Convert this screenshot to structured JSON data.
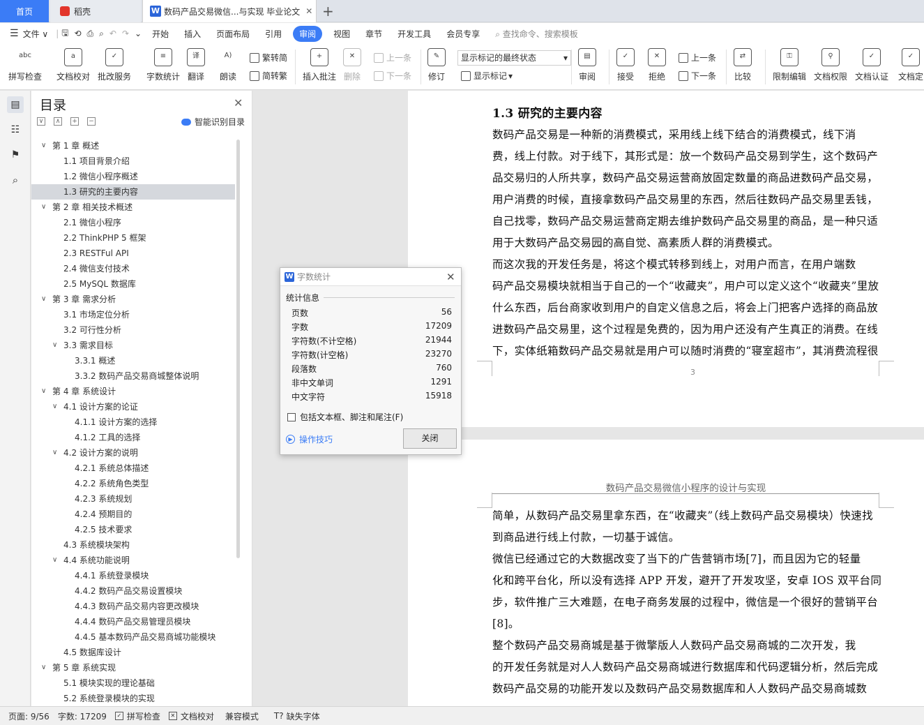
{
  "tabs": {
    "home": "首页",
    "daoke": "稻壳",
    "doc": "数码产品交易微信...与实现 毕业论文",
    "add": "+"
  },
  "menu": {
    "file": "文件",
    "items": [
      "开始",
      "插入",
      "页面布局",
      "引用",
      "审阅",
      "视图",
      "章节",
      "开发工具",
      "会员专享"
    ],
    "search": "查找命令、搜索模板"
  },
  "ribbon": {
    "spellcheck": "拼写检查",
    "doc_proof": "文档校对",
    "review_service": "批改服务",
    "word_count": "字数统计",
    "translate": "翻译",
    "read_aloud": "朗读",
    "trad": "繁转简",
    "simp": "简转繁",
    "insert_comment": "插入批注",
    "delete": "删除",
    "prev": "上一条",
    "next": "下一条",
    "revise": "修订",
    "show_state": "显示标记的最终状态",
    "show_marks": "显示标记",
    "review": "审阅",
    "accept": "接受",
    "reject": "拒绝",
    "prev2": "上一条",
    "next2": "下一条",
    "compare": "比较",
    "restrict": "限制编辑",
    "doc_rights": "文档权限",
    "doc_cert": "文档认证",
    "doc_final": "文档定"
  },
  "toc": {
    "title": "目录",
    "smart": "智能识别目录",
    "items": [
      {
        "text": "第 1 章  概述",
        "level": 1,
        "arrow": "∨"
      },
      {
        "text": "1.1  项目背景介绍",
        "level": 2
      },
      {
        "text": "1.2  微信小程序概述",
        "level": 2
      },
      {
        "text": "1.3  研究的主要内容",
        "level": 2,
        "selected": true
      },
      {
        "text": "第 2 章  相关技术概述",
        "level": 1,
        "arrow": "∨"
      },
      {
        "text": "2.1  微信小程序",
        "level": 2
      },
      {
        "text": "2.2 ThinkPHP 5  框架",
        "level": 2
      },
      {
        "text": "2.3 RESTFul API",
        "level": 2
      },
      {
        "text": "2.4  微信支付技术",
        "level": 2
      },
      {
        "text": "2.5 MySQL 数据库",
        "level": 2
      },
      {
        "text": "第 3 章  需求分析",
        "level": 1,
        "arrow": "∨"
      },
      {
        "text": "3.1  市场定位分析",
        "level": 2
      },
      {
        "text": "3.2  可行性分析",
        "level": 2
      },
      {
        "text": "3.3  需求目标",
        "level": 2,
        "arrow": "∨"
      },
      {
        "text": "3.3.1  概述",
        "level": 3
      },
      {
        "text": "3.3.2  数码产品交易商城整体说明",
        "level": 3
      },
      {
        "text": "第 4 章  系统设计",
        "level": 1,
        "arrow": "∨"
      },
      {
        "text": "4.1 设计方案的论证",
        "level": 2,
        "arrow": "∨"
      },
      {
        "text": "4.1.1  设计方案的选择",
        "level": 3
      },
      {
        "text": "4.1.2  工具的选择",
        "level": 3
      },
      {
        "text": "4.2  设计方案的说明",
        "level": 2,
        "arrow": "∨"
      },
      {
        "text": "4.2.1  系统总体描述",
        "level": 3
      },
      {
        "text": "4.2.2  系统角色类型",
        "level": 3
      },
      {
        "text": "4.2.3  系统规划",
        "level": 3
      },
      {
        "text": "4.2.4  预期目的",
        "level": 3
      },
      {
        "text": "4.2.5  技术要求",
        "level": 3
      },
      {
        "text": "4.3  系统模块架构",
        "level": 2
      },
      {
        "text": "4.4  系统功能说明",
        "level": 2,
        "arrow": "∨"
      },
      {
        "text": "4.4.1  系统登录模块",
        "level": 3
      },
      {
        "text": "4.4.2  数码产品交易设置模块",
        "level": 3
      },
      {
        "text": "4.4.3  数码产品交易内容更改模块",
        "level": 3
      },
      {
        "text": "4.4.4  数码产品交易管理员模块",
        "level": 3
      },
      {
        "text": "4.4.5  基本数码产品交易商城功能模块",
        "level": 3
      },
      {
        "text": "4.5  数据库设计",
        "level": 2
      },
      {
        "text": "第 5 章  系统实现",
        "level": 1,
        "arrow": "∨"
      },
      {
        "text": "5.1  模块实现的理论基础",
        "level": 2
      },
      {
        "text": "5.2  系统登录模块的实现",
        "level": 2
      }
    ]
  },
  "page1": {
    "heading": "1.3  研究的主要内容",
    "lines": [
      "    数码产品交易是一种新的消费模式，采用线上线下结合的消费模式，线下消",
      "费，线上付款。对于线下，其形式是：放一个数码产品交易到学生，这个数码产",
      "品交易归的人所共享，数码产品交易运营商放固定数量的商品进数码产品交易，",
      "用户消费的时候，直接拿数码产品交易里的东西，然后往数码产品交易里丢钱，",
      "自己找零，数码产品交易运营商定期去维护数码产品交易里的商品，是一种只适",
      "用于大数码产品交易园的高自觉、高素质人群的消费模式。",
      "    而这次我的开发任务是，将这个模式转移到线上，对用户而言，在用户端数",
      "码产品交易模块就相当于自己的一个“收藏夹”，用户可以定义这个“收藏夹”里放",
      "什么东西，后台商家收到用户的自定义信息之后，将会上门把客户选择的商品放",
      "进数码产品交易里，这个过程是免费的，因为用户还没有产生真正的消费。在线",
      "下，实体纸箱数码产品交易就是用户可以随时消费的“寝室超市”，其消费流程很"
    ],
    "page_number": "3"
  },
  "page2": {
    "header": "数码产品交易微信小程序的设计与实现",
    "lines": [
      "简单，从数码产品交易里拿东西，在“收藏夹”（线上数码产品交易模块）快速找",
      "到商品进行线上付款，一切基于诚信。",
      "    微信已经通过它的大数据改变了当下的广告营销市场[7]，而且因为它的轻量",
      "化和跨平台化，所以没有选择 APP 开发，避开了开发攻坚，安卓 IOS 双平台同",
      "步，软件推广三大难题，在电子商务发展的过程中，微信是一个很好的营销平台",
      "[8]。",
      "    整个数码产品交易商城是基于微擎版人人数码产品交易商城的二次开发，我",
      "的开发任务就是对人人数码产品交易商城进行数据库和代码逻辑分析，然后完成",
      "数码产品交易的功能开发以及数码产品交易数据库和人人数码产品交易商城数"
    ]
  },
  "dialog": {
    "title": "字数统计",
    "section": "统计信息",
    "stats": [
      {
        "label": "页数",
        "value": "56"
      },
      {
        "label": "字数",
        "value": "17209"
      },
      {
        "label": "字符数(不计空格)",
        "value": "21944"
      },
      {
        "label": "字符数(计空格)",
        "value": "23270"
      },
      {
        "label": "段落数",
        "value": "760"
      },
      {
        "label": "非中文单词",
        "value": "1291"
      },
      {
        "label": "中文字符",
        "value": "15918"
      }
    ],
    "checkbox": "包括文本框、脚注和尾注(F)",
    "tips": "操作技巧",
    "close": "关闭"
  },
  "status": {
    "page": "页面: 9/56",
    "words": "字数: 17209",
    "spell": "拼写检查",
    "proof": "文档校对",
    "compat": "兼容模式",
    "missing_font": "缺失字体"
  }
}
